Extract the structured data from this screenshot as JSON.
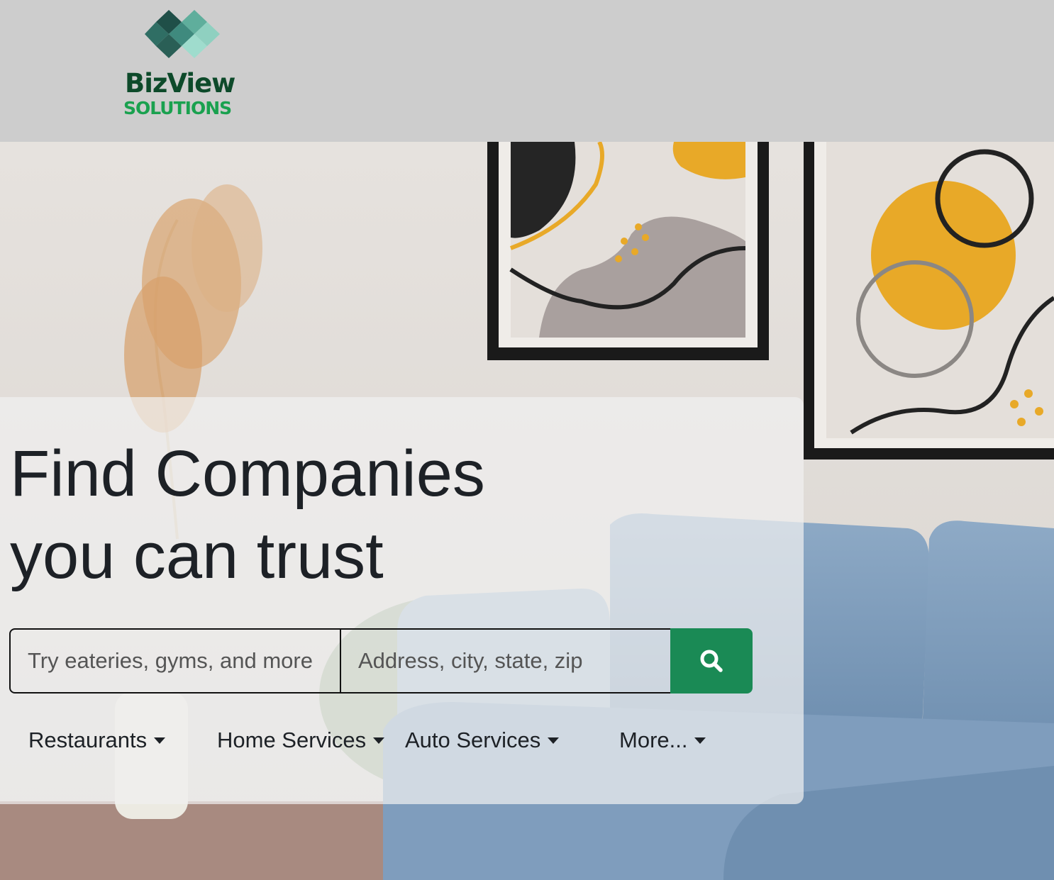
{
  "header": {
    "logo_line1": "BizView",
    "logo_line2": "SOLUTIONS",
    "brand_colors": {
      "dark": "#0d4a2a",
      "green": "#1aa14f",
      "teal_dark": "#1f4f48",
      "teal_mid": "#3f8a7e",
      "teal_light": "#8fd0c0"
    }
  },
  "hero": {
    "title_line1": "Find Companies",
    "title_line2": "you can trust",
    "search": {
      "what_placeholder": "Try eateries, gyms, and more",
      "where_placeholder": "Address, city, state, zip",
      "button_icon": "search-icon",
      "button_color": "#1a8a55"
    },
    "categories": [
      {
        "label": "Restaurants"
      },
      {
        "label": "Home Services"
      },
      {
        "label": "Auto Services"
      },
      {
        "label": "More..."
      }
    ]
  }
}
